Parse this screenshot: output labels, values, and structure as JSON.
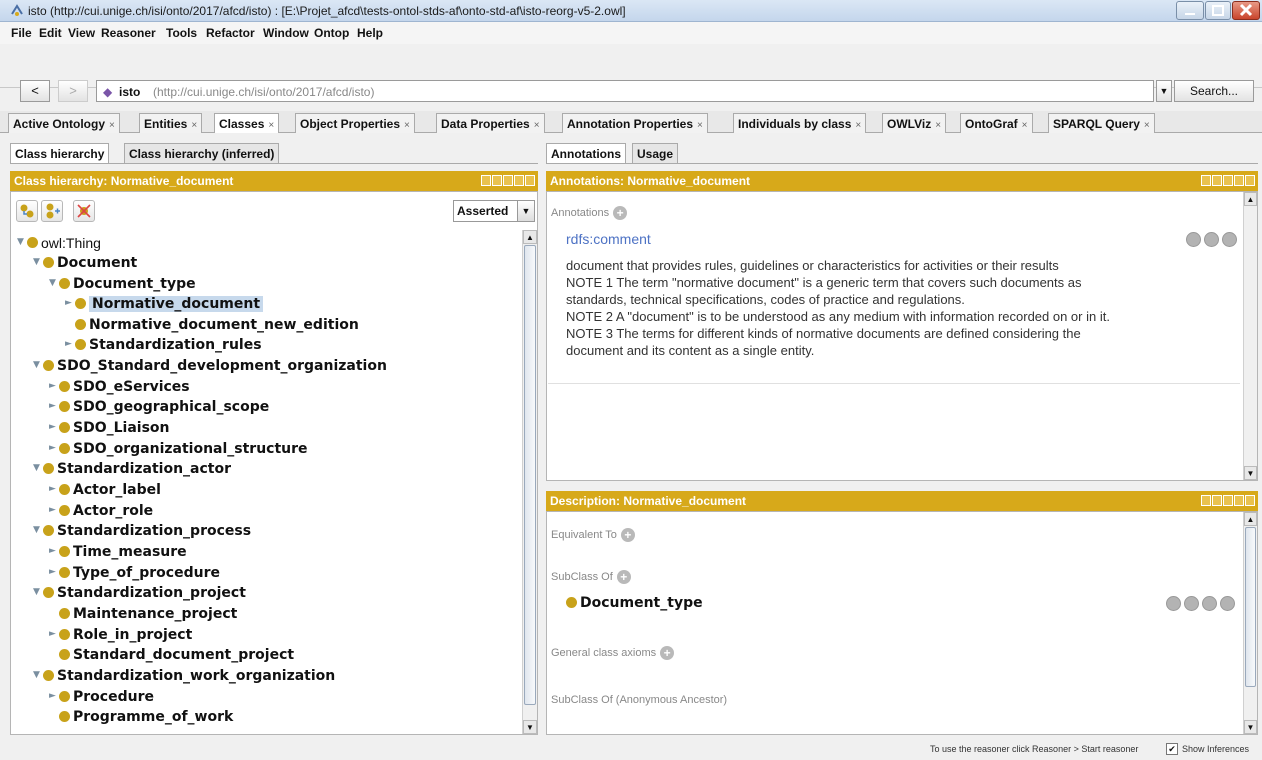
{
  "window": {
    "title": "isto (http://cui.unige.ch/isi/onto/2017/afcd/isto)  : [E:\\Projet_afcd\\tests-ontol-stds-af\\onto-std-af\\isto-reorg-v5-2.owl]"
  },
  "menu": [
    "File",
    "Edit",
    "View",
    "Reasoner",
    "Tools",
    "Refactor",
    "Window",
    "Ontop",
    "Help"
  ],
  "nav": {
    "back_label": "<",
    "forward_label": ">",
    "ontology_name": "isto",
    "ontology_uri": "(http://cui.unige.ch/isi/onto/2017/afcd/isto)",
    "search_label": "Search..."
  },
  "tabs": [
    {
      "label": "Active Ontology"
    },
    {
      "label": "Entities"
    },
    {
      "label": "Classes"
    },
    {
      "label": "Object Properties"
    },
    {
      "label": "Data Properties"
    },
    {
      "label": "Annotation Properties"
    },
    {
      "label": "Individuals by class"
    },
    {
      "label": "OWLViz"
    },
    {
      "label": "OntoGraf"
    },
    {
      "label": "SPARQL Query"
    }
  ],
  "left": {
    "subtabs": [
      "Class hierarchy",
      "Class hierarchy (inferred)"
    ],
    "header": "Class hierarchy: Normative_document",
    "asserted_label": "Asserted",
    "tree": [
      {
        "label": "owl:Thing",
        "toggle": "▼"
      },
      {
        "label": "Document",
        "toggle": "▼"
      },
      {
        "label": "Document_type",
        "toggle": "▼"
      },
      {
        "label": "Normative_document",
        "toggle": "►"
      },
      {
        "label": "Normative_document_new_edition",
        "toggle": ""
      },
      {
        "label": "Standardization_rules",
        "toggle": "►"
      },
      {
        "label": "SDO_Standard_development_organization",
        "toggle": "▼"
      },
      {
        "label": "SDO_eServices",
        "toggle": "►"
      },
      {
        "label": "SDO_geographical_scope",
        "toggle": "►"
      },
      {
        "label": "SDO_Liaison",
        "toggle": "►"
      },
      {
        "label": "SDO_organizational_structure",
        "toggle": "►"
      },
      {
        "label": "Standardization_actor",
        "toggle": "▼"
      },
      {
        "label": "Actor_label",
        "toggle": "►"
      },
      {
        "label": "Actor_role",
        "toggle": "►"
      },
      {
        "label": "Standardization_process",
        "toggle": "▼"
      },
      {
        "label": "Time_measure",
        "toggle": "►"
      },
      {
        "label": "Type_of_procedure",
        "toggle": "►"
      },
      {
        "label": "Standardization_project",
        "toggle": "▼"
      },
      {
        "label": "Maintenance_project",
        "toggle": ""
      },
      {
        "label": "Role_in_project",
        "toggle": "►"
      },
      {
        "label": "Standard_document_project",
        "toggle": ""
      },
      {
        "label": "Standardization_work_organization",
        "toggle": "▼"
      },
      {
        "label": "Procedure",
        "toggle": "►"
      },
      {
        "label": "Programme_of_work",
        "toggle": ""
      }
    ]
  },
  "right": {
    "subtabs": [
      "Annotations",
      "Usage"
    ],
    "annotations_header": "Annotations: Normative_document",
    "annotations_label": "Annotations",
    "annotation_property": "rdfs:comment",
    "comment_lines": [
      "document that provides rules, guidelines or characteristics for activities or their results",
      "NOTE 1 The term \"normative document\" is a generic term that covers such documents as",
      "standards, technical specifications, codes of practice and regulations.",
      "NOTE 2 A \"document\" is to be understood as any medium with information recorded on or in it.",
      "NOTE 3 The terms for different kinds of normative documents are defined considering the",
      "document and its content as a single entity."
    ],
    "description_header": "Description: Normative_document",
    "equivalent_to": "Equivalent To",
    "subclass_of": "SubClass Of",
    "subclass_value": "Document_type",
    "general_axioms": "General class axioms",
    "anon_ancestor": "SubClass Of (Anonymous Ancestor)"
  },
  "status": {
    "reasoner_hint": "To use the reasoner click Reasoner > Start reasoner",
    "show_inferences": "Show Inferences",
    "show_inferences_checked": "✔"
  },
  "colors": {
    "header_gold": "#d7a91a",
    "class_dot": "#c8a21a",
    "link_blue": "#4d72c4"
  }
}
